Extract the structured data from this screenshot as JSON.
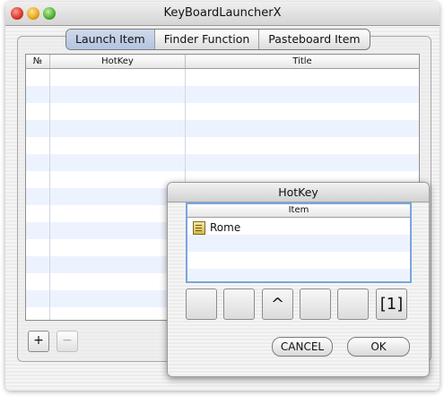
{
  "window": {
    "title": "KeyBoardLauncherX"
  },
  "tabs": [
    {
      "label": "Launch Item"
    },
    {
      "label": "Finder Function"
    },
    {
      "label": "Pasteboard Item"
    }
  ],
  "table": {
    "columns": [
      "№",
      "HotKey",
      "Title"
    ],
    "rows": []
  },
  "buttons": {
    "add": "+",
    "remove": "−"
  },
  "sheet": {
    "title": "HotKey",
    "column": "Item",
    "items": [
      {
        "icon": "document-icon",
        "label": "Rome"
      }
    ],
    "keys": [
      "",
      "",
      "^",
      "",
      "",
      "[1]"
    ],
    "cancel": "CANCEL",
    "ok": "OK"
  }
}
